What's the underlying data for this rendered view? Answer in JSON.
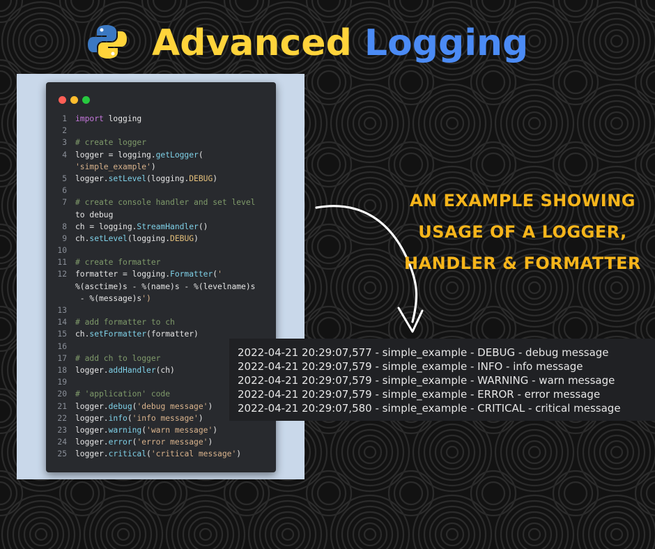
{
  "header": {
    "logo_icon": "python-logo-icon",
    "title_part1": "Advanced",
    "title_part2": "Logging",
    "color_part1": "#ffd43b",
    "color_part2": "#4b8bf5"
  },
  "caption": {
    "line1": "AN EXAMPLE SHOWING",
    "line2": "USAGE OF A LOGGER,",
    "line3": "HANDLER & FORMATTER",
    "color": "#f6b51b"
  },
  "code_window": {
    "window_dots": [
      "#ff5f56",
      "#ffbd2e",
      "#27c93f"
    ],
    "lines": [
      {
        "n": "1",
        "t": "import logging"
      },
      {
        "n": "2",
        "t": ""
      },
      {
        "n": "3",
        "t": "# create logger"
      },
      {
        "n": "4",
        "t": "logger = logging.getLogger("
      },
      {
        "n": "",
        "t": "'simple_example')"
      },
      {
        "n": "5",
        "t": "logger.setLevel(logging.DEBUG)"
      },
      {
        "n": "6",
        "t": ""
      },
      {
        "n": "7",
        "t": "# create console handler and set level"
      },
      {
        "n": "",
        "t": "to debug"
      },
      {
        "n": "8",
        "t": "ch = logging.StreamHandler()"
      },
      {
        "n": "9",
        "t": "ch.setLevel(logging.DEBUG)"
      },
      {
        "n": "10",
        "t": ""
      },
      {
        "n": "11",
        "t": "# create formatter"
      },
      {
        "n": "12",
        "t": "formatter = logging.Formatter('"
      },
      {
        "n": "",
        "t": "%(asctime)s - %(name)s - %(levelname)s"
      },
      {
        "n": "",
        "t": " - %(message)s')"
      },
      {
        "n": "13",
        "t": ""
      },
      {
        "n": "14",
        "t": "# add formatter to ch"
      },
      {
        "n": "15",
        "t": "ch.setFormatter(formatter)"
      },
      {
        "n": "16",
        "t": ""
      },
      {
        "n": "17",
        "t": "# add ch to logger"
      },
      {
        "n": "18",
        "t": "logger.addHandler(ch)"
      },
      {
        "n": "19",
        "t": ""
      },
      {
        "n": "20",
        "t": "# 'application' code"
      },
      {
        "n": "21",
        "t": "logger.debug('debug message')"
      },
      {
        "n": "22",
        "t": "logger.info('info message')"
      },
      {
        "n": "23",
        "t": "logger.warning('warn message')"
      },
      {
        "n": "24",
        "t": "logger.error('error message')"
      },
      {
        "n": "25",
        "t": "logger.critical('critical message')"
      }
    ]
  },
  "terminal": {
    "lines": [
      "2022-04-21 20:29:07,577 - simple_example - DEBUG - debug message",
      "2022-04-21 20:29:07,579 - simple_example - INFO - info message",
      "2022-04-21 20:29:07,579 - simple_example - WARNING - warn message",
      "2022-04-21 20:29:07,579 - simple_example - ERROR - error message",
      "2022-04-21 20:29:07,580 - simple_example - CRITICAL - critical message"
    ]
  }
}
